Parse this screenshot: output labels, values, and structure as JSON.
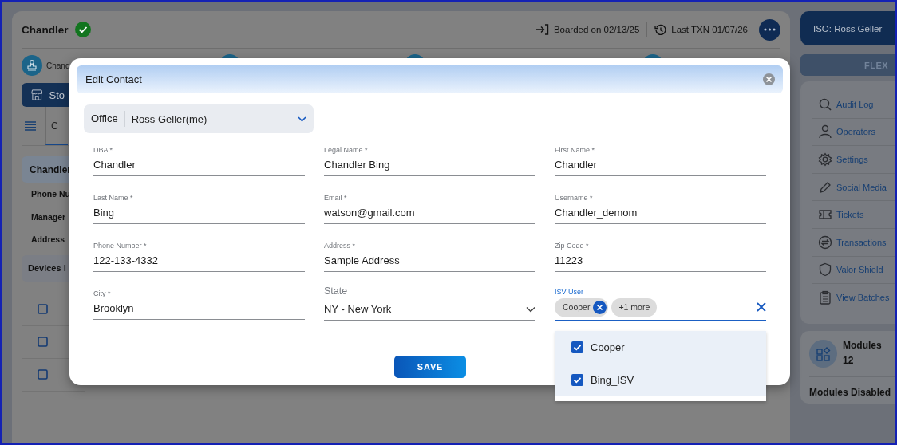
{
  "header": {
    "title": "Chandler",
    "verified": true,
    "boarded": "Boarded on 02/13/25",
    "last_txn": "Last TXN 01/07/26"
  },
  "profile_label": "Chand",
  "store_tab": "Sto",
  "subtab": "C",
  "section": "Chandler",
  "info_labels": [
    "Phone Nu",
    "Manager",
    "Address"
  ],
  "devices_title": "Devices i",
  "device_rows": [
    {
      "checked": false
    },
    {
      "checked": false
    },
    {
      "checked": false
    }
  ],
  "sidebar": {
    "iso": "ISO: Ross Geller",
    "flex": "FLEX",
    "items": [
      {
        "label": "Audit Log",
        "kind": "search"
      },
      {
        "label": "Operators",
        "kind": "person"
      },
      {
        "label": "Settings",
        "kind": "gear"
      },
      {
        "label": "Social Media",
        "kind": "pencil"
      },
      {
        "label": "Tickets",
        "kind": "ticket"
      },
      {
        "label": "Transactions",
        "kind": "swap"
      },
      {
        "label": "Valor Shield",
        "kind": "shield"
      },
      {
        "label": "View Batches",
        "kind": "clipboard"
      }
    ],
    "modules": {
      "title": "Modules",
      "count": "12",
      "disabled": "Modules Disabled"
    }
  },
  "modal": {
    "title": "Edit Contact",
    "office": {
      "label": "Office",
      "value": "Ross Geller(me)"
    },
    "fields": [
      {
        "kind": "text",
        "label": "DBA *",
        "value": "Chandler"
      },
      {
        "kind": "text",
        "label": "Legal Name *",
        "value": "Chandler Bing"
      },
      {
        "kind": "text",
        "label": "First Name *",
        "value": "Chandler"
      },
      {
        "kind": "text",
        "label": "Last Name *",
        "value": "Bing"
      },
      {
        "kind": "text",
        "label": "Email *",
        "value": "watson@gmail.com"
      },
      {
        "kind": "text",
        "label": "Username *",
        "value": "Chandler_demom"
      },
      {
        "kind": "text",
        "label": "Phone Number *",
        "value": "122-133-4332"
      },
      {
        "kind": "text",
        "label": "Address *",
        "value": "Sample Address"
      },
      {
        "kind": "text",
        "label": "Zip Code *",
        "value": "11223"
      },
      {
        "kind": "text",
        "label": "City *",
        "value": "Brooklyn"
      },
      {
        "kind": "select",
        "label": "State",
        "value": "NY - New York"
      },
      {
        "kind": "multi",
        "label": "ISV User",
        "chips": [
          "Cooper"
        ],
        "more": "+1 more"
      }
    ],
    "save": "SAVE",
    "options": [
      {
        "label": "Cooper",
        "checked": true
      },
      {
        "label": "Bing_ISV",
        "checked": true
      }
    ]
  }
}
